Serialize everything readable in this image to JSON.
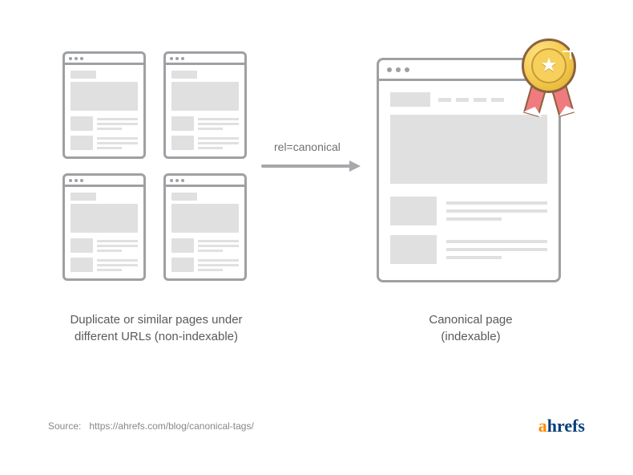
{
  "arrow_label": "rel=canonical",
  "captions": {
    "left_line1": "Duplicate or similar pages under",
    "left_line2": "different URLs (non-indexable)",
    "right_line1": "Canonical page",
    "right_line2": "(indexable)"
  },
  "footer": {
    "source_label": "Source:",
    "source_url": "https://ahrefs.com/blog/canonical-tags/",
    "brand_a": "a",
    "brand_rest": "hrefs"
  },
  "medal": {
    "icon_glyph": "★"
  }
}
